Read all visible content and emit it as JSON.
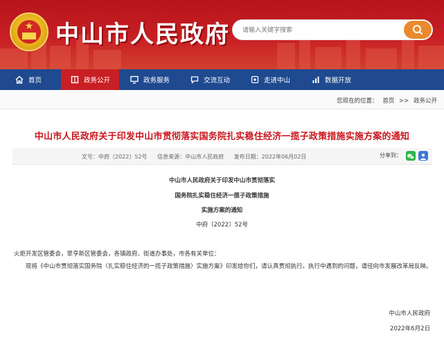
{
  "header": {
    "site_title": "中山市人民政府",
    "search": {
      "placeholder": "请输入关键字搜索"
    }
  },
  "nav": {
    "items": [
      {
        "label": "首页",
        "icon": "home-icon"
      },
      {
        "label": "政务公开",
        "icon": "book-icon",
        "active": true
      },
      {
        "label": "政务服务",
        "icon": "monitor-icon"
      },
      {
        "label": "交流互动",
        "icon": "chat-icon"
      },
      {
        "label": "走进中山",
        "icon": "location-icon"
      },
      {
        "label": "数据开放",
        "icon": "chart-icon"
      }
    ]
  },
  "breadcrumb": {
    "prefix": "您现在的位置：",
    "items": [
      "首页",
      ">>",
      "政务公开"
    ]
  },
  "article": {
    "title": "中山市人民政府关于印发中山市贯彻落实国务院扎实稳住经济一揽子政策措施实施方案的通知",
    "meta": {
      "doc_no": "文号：中府〔2022〕52号",
      "source": "信息来源：中山市人民政府",
      "date": "发布日期：2022年06月02日",
      "share_label": "分享到："
    },
    "heading_lines": [
      "中山市人民政府关于印发中山市贯彻落实",
      "国务院扎实稳住经济一揽子政策措施",
      "实施方案的通知"
    ],
    "doc_number": "中府〔2022〕52号",
    "addressee": "火炬开发区管委会，翠亨新区管委会，各镇政府、街道办事处，市各有关单位：",
    "body": "现将《中山市贯彻落实国务院〈扎实稳住经济的一揽子政策措施〉实施方案》印发给你们，请认真贯彻执行。执行中遇到的问题，请径向市发展改革局反映。",
    "signature": "中山市人民政府",
    "sign_date": "2022年6月2日"
  },
  "colors": {
    "header_red": "#c81f24",
    "nav_blue": "#1f4a8f",
    "title_red": "#c8161d",
    "search_orange": "#e98a2e"
  }
}
